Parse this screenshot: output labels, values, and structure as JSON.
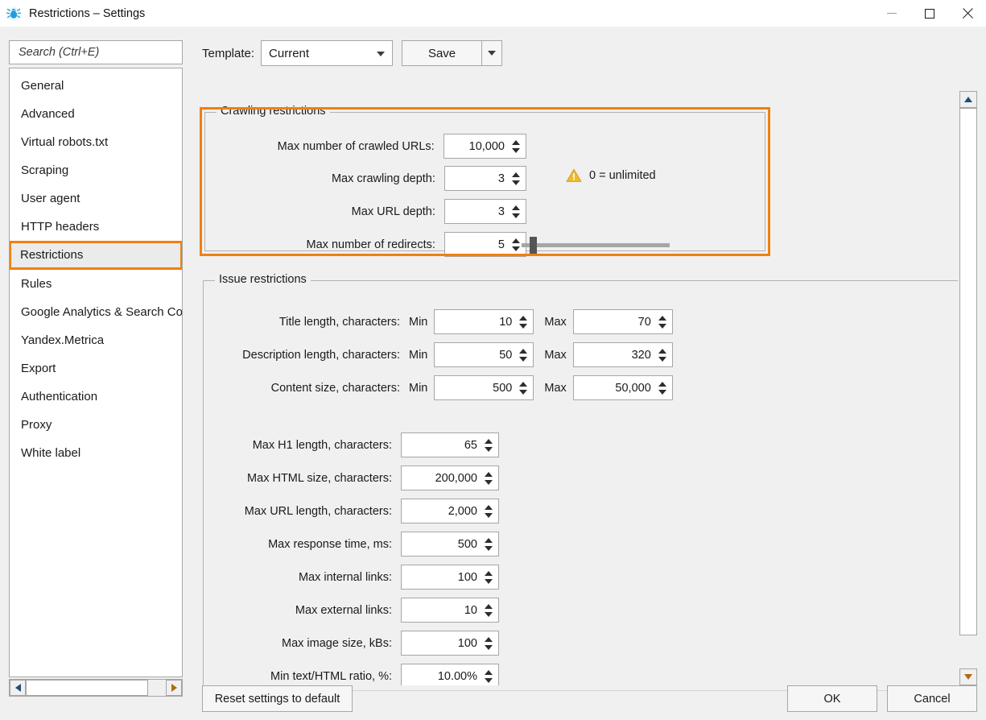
{
  "window": {
    "title": "Restrictions – Settings",
    "app_icon": "spider-icon",
    "minimize_label": "Minimize",
    "maximize_label": "Maximize",
    "close_label": "Close"
  },
  "sidebar": {
    "search_placeholder": "Search (Ctrl+E)",
    "search_value": "",
    "items": [
      {
        "label": "General",
        "selected": false
      },
      {
        "label": "Advanced",
        "selected": false
      },
      {
        "label": "Virtual robots.txt",
        "selected": false
      },
      {
        "label": "Scraping",
        "selected": false
      },
      {
        "label": "User agent",
        "selected": false
      },
      {
        "label": "HTTP headers",
        "selected": false
      },
      {
        "label": "Restrictions",
        "selected": true
      },
      {
        "label": "Rules",
        "selected": false
      },
      {
        "label": "Google Analytics & Search Co",
        "selected": false
      },
      {
        "label": "Yandex.Metrica",
        "selected": false
      },
      {
        "label": "Export",
        "selected": false
      },
      {
        "label": "Authentication",
        "selected": false
      },
      {
        "label": "Proxy",
        "selected": false
      },
      {
        "label": "White label",
        "selected": false
      }
    ]
  },
  "toolbar": {
    "template_label": "Template:",
    "template_value": "Current",
    "save_label": "Save"
  },
  "crawling_restrictions": {
    "title": "Crawling restrictions",
    "highlighted": true,
    "fields": [
      {
        "label": "Max number of crawled URLs:",
        "value": "10,000"
      },
      {
        "label": "Max crawling depth:",
        "value": "3"
      },
      {
        "label": "Max URL depth:",
        "value": "3"
      },
      {
        "label": "Max number of redirects:",
        "value": "5"
      }
    ],
    "note": {
      "icon": "warning-icon",
      "text": "0 = unlimited",
      "color": "#e8b530"
    },
    "slider": {
      "value": 5,
      "min": 0,
      "max": 100
    }
  },
  "issue_restrictions": {
    "title": "Issue restrictions",
    "min_label": "Min",
    "max_label": "Max",
    "range_fields": [
      {
        "label": "Title length, characters:",
        "min": "10",
        "max": "70"
      },
      {
        "label": "Description length, characters:",
        "min": "50",
        "max": "320"
      },
      {
        "label": "Content size, characters:",
        "min": "500",
        "max": "50,000"
      }
    ],
    "single_fields": [
      {
        "label": "Max H1 length, characters:",
        "value": "65"
      },
      {
        "label": "Max HTML size, characters:",
        "value": "200,000"
      },
      {
        "label": "Max URL length, characters:",
        "value": "2,000"
      },
      {
        "label": "Max response time, ms:",
        "value": "500"
      },
      {
        "label": "Max internal links:",
        "value": "100"
      },
      {
        "label": "Max external links:",
        "value": "10"
      },
      {
        "label": "Max image size, kBs:",
        "value": "100"
      },
      {
        "label": "Min text/HTML ratio, %:",
        "value": "10.00%"
      }
    ]
  },
  "footer": {
    "reset_label": "Reset settings to default",
    "ok_label": "OK",
    "cancel_label": "Cancel"
  },
  "colors": {
    "accent_orange": "#f08010",
    "warning_yellow": "#e8b530",
    "window_bg": "#f0f0f0",
    "field_bg": "#ffffff",
    "border": "#a6a6a6"
  }
}
